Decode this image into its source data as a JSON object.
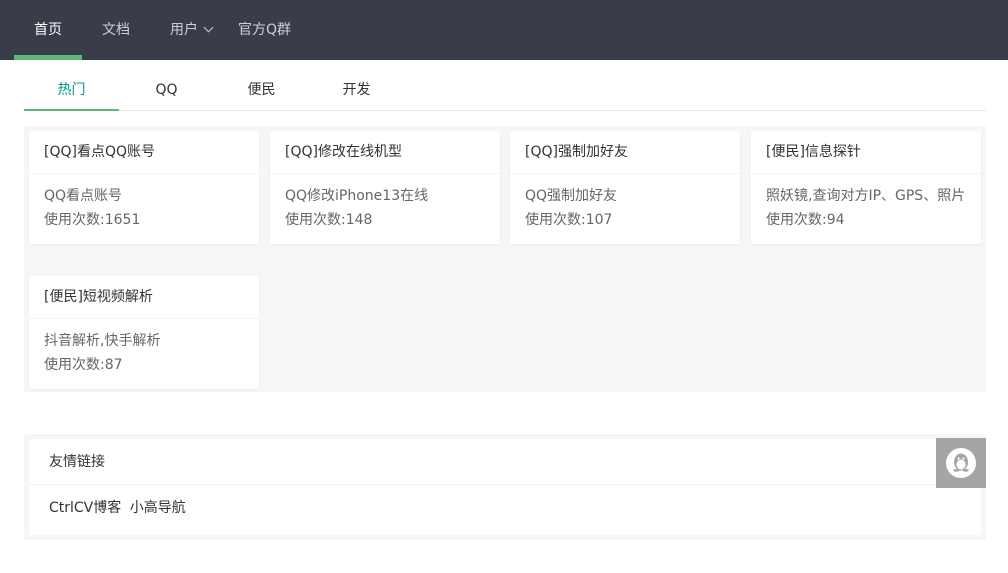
{
  "nav": {
    "items": [
      {
        "label": "首页",
        "active": true
      },
      {
        "label": "文档"
      },
      {
        "label": "用户"
      },
      {
        "label": "官方Q群"
      }
    ]
  },
  "tabs": [
    {
      "label": "热门",
      "active": true
    },
    {
      "label": "QQ"
    },
    {
      "label": "便民"
    },
    {
      "label": "开发"
    }
  ],
  "cards": [
    {
      "title": "[QQ]看点QQ账号",
      "desc": "QQ看点账号",
      "count": "使用次数:1651"
    },
    {
      "title": "[QQ]修改在线机型",
      "desc": "QQ修改iPhone13在线",
      "count": "使用次数:148"
    },
    {
      "title": "[QQ]强制加好友",
      "desc": "QQ强制加好友",
      "count": "使用次数:107"
    },
    {
      "title": "[便民]信息探针",
      "desc": "照妖镜,查询对方IP、GPS、照片",
      "count": "使用次数:94"
    },
    {
      "title": "[便民]短视频解析",
      "desc": "抖音解析,快手解析",
      "count": "使用次数:87"
    }
  ],
  "links": {
    "title": "友情链接",
    "items": [
      "CtrlCV博客",
      "小高导航"
    ]
  },
  "float_button": {
    "icon": "qq-penguin-icon"
  },
  "colors": {
    "nav_bg": "#393d49",
    "accent_green": "#5fb878",
    "active_tab_text": "#009688",
    "panel_bg": "#f6f6f6",
    "float_bg": "#a5a5a5"
  }
}
